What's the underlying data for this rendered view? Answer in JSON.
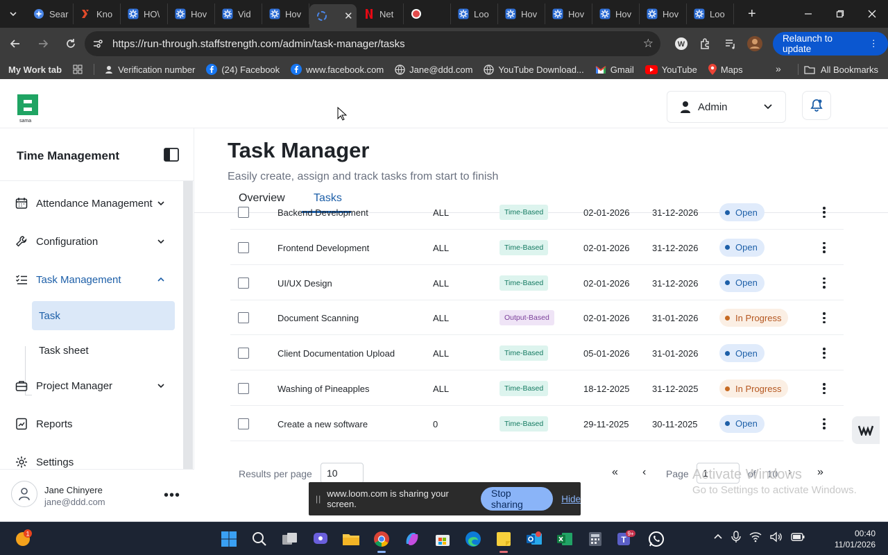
{
  "browser": {
    "tabs": [
      {
        "label": "Sear",
        "icon": "google-search-favicon"
      },
      {
        "label": "Kno",
        "icon": "knowledge-favicon"
      },
      {
        "label": "HO\\",
        "icon": "app-gear-favicon"
      },
      {
        "label": "Hov",
        "icon": "app-gear-favicon"
      },
      {
        "label": "Vid",
        "icon": "app-gear-favicon"
      },
      {
        "label": "Hov",
        "icon": "app-gear-favicon"
      },
      {
        "label": "",
        "icon": "loading-favicon",
        "active": true
      },
      {
        "label": "Net",
        "icon": "netflix-favicon"
      },
      {
        "label": "",
        "icon": "record-favicon"
      },
      {
        "label": "Loo",
        "icon": "app-gear-favicon"
      },
      {
        "label": "Hov",
        "icon": "app-gear-favicon"
      },
      {
        "label": "Hov",
        "icon": "app-gear-favicon"
      },
      {
        "label": "Hov",
        "icon": "app-gear-favicon"
      },
      {
        "label": "Hov",
        "icon": "app-gear-favicon"
      },
      {
        "label": "Loo",
        "icon": "app-gear-favicon"
      }
    ],
    "url": "https://run-through.staffstrength.com/admin/task-manager/tasks",
    "relaunch_label": "Relaunch to update",
    "bookmarks": [
      {
        "label": "My Work tab"
      },
      {
        "label": "Verification number"
      },
      {
        "label": "(24) Facebook"
      },
      {
        "label": "www.facebook.com"
      },
      {
        "label": "Jane@ddd.com"
      },
      {
        "label": "YouTube Download..."
      },
      {
        "label": "Gmail"
      },
      {
        "label": "YouTube"
      },
      {
        "label": "Maps"
      }
    ],
    "all_bookmarks_label": "All Bookmarks"
  },
  "header": {
    "logo_text": "sama",
    "role_label": "Admin"
  },
  "sidebar": {
    "title": "Time Management",
    "items": [
      {
        "label": "Attendance Management"
      },
      {
        "label": "Configuration"
      },
      {
        "label": "Task Management"
      },
      {
        "label": "Project Manager"
      },
      {
        "label": "Reports"
      },
      {
        "label": "Settings"
      }
    ],
    "sub_items": [
      {
        "label": "Task"
      },
      {
        "label": "Task sheet"
      }
    ],
    "user": {
      "name": "Jane Chinyere",
      "email": "jane@ddd.com"
    }
  },
  "main": {
    "title": "Task Manager",
    "subtitle": "Easily create, assign and track tasks from start to finish",
    "tabs": [
      {
        "label": "Overview"
      },
      {
        "label": "Tasks"
      }
    ],
    "rows": [
      {
        "name": "Backend Development",
        "assignee": "ALL",
        "type": "Time-Based",
        "start": "02-01-2026",
        "end": "31-12-2026",
        "status": "Open"
      },
      {
        "name": "Frontend Development",
        "assignee": "ALL",
        "type": "Time-Based",
        "start": "02-01-2026",
        "end": "31-12-2026",
        "status": "Open"
      },
      {
        "name": "UI/UX Design",
        "assignee": "ALL",
        "type": "Time-Based",
        "start": "02-01-2026",
        "end": "31-12-2026",
        "status": "Open"
      },
      {
        "name": "Document Scanning",
        "assignee": "ALL",
        "type": "Output-Based",
        "start": "02-01-2026",
        "end": "31-01-2026",
        "status": "In Progress"
      },
      {
        "name": "Client Documentation Upload",
        "assignee": "ALL",
        "type": "Time-Based",
        "start": "05-01-2026",
        "end": "31-01-2026",
        "status": "Open"
      },
      {
        "name": "Washing of Pineapples",
        "assignee": "ALL",
        "type": "Time-Based",
        "start": "18-12-2025",
        "end": "31-12-2025",
        "status": "In Progress"
      },
      {
        "name": "Create a new software",
        "assignee": "0",
        "type": "Time-Based",
        "start": "29-11-2025",
        "end": "30-11-2025",
        "status": "Open"
      }
    ],
    "pagination": {
      "results_label": "Results per page",
      "per_page": "10",
      "page_label": "Page",
      "current_page": "1",
      "of_label": "of",
      "total_pages": "10"
    }
  },
  "overlays": {
    "watermark_title": "Activate Windows",
    "watermark_sub": "Go to Settings to activate Windows.",
    "share_text": "www.loom.com is sharing your screen.",
    "stop_label": "Stop sharing",
    "hide_label": "Hide"
  },
  "taskbar": {
    "time": "00:40",
    "date": "11/01/2026",
    "teams_badge": "9+",
    "notif_badge": "1"
  },
  "colors": {
    "accent": "#1d5fa8",
    "time_based_bg": "#ddf4ee",
    "output_based_bg": "#efe4f6",
    "open_bg": "#e0ebfb",
    "in_progress_bg": "#fbefe4",
    "brand_green": "#1fa463",
    "relaunch_blue": "#0b57d0"
  }
}
